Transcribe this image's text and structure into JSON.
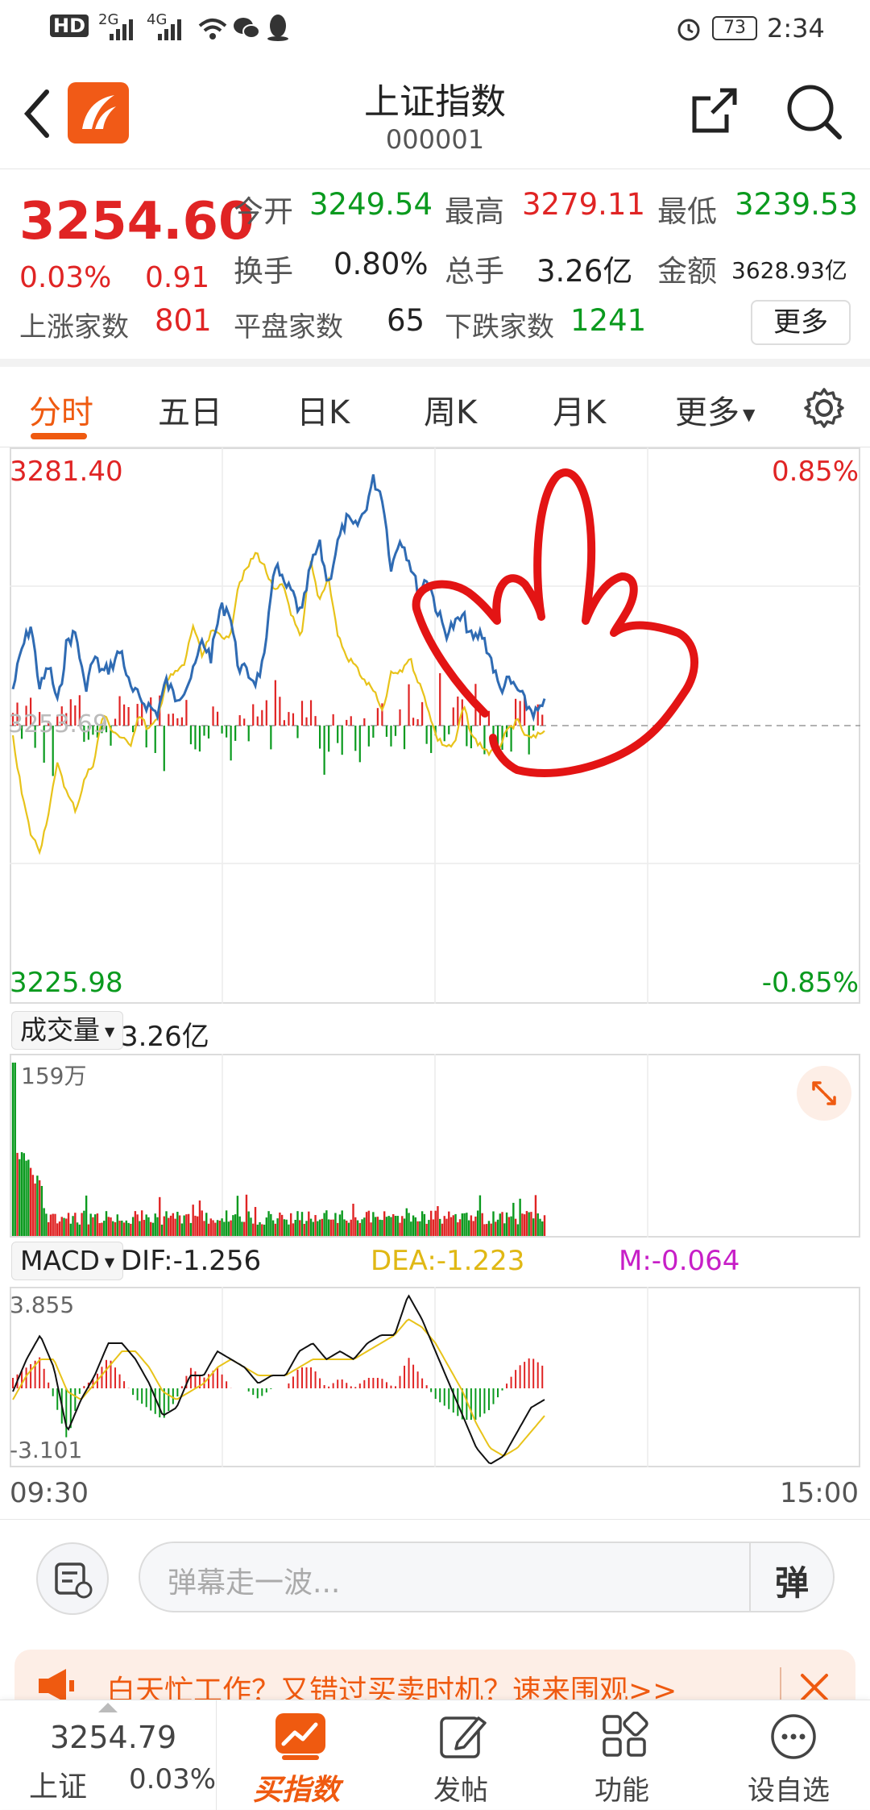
{
  "status_bar": {
    "hd": "HD",
    "net1": "2G",
    "net2": "4G",
    "battery": "73",
    "time": "2:34"
  },
  "nav": {
    "title": "上证指数",
    "code": "000001"
  },
  "quote": {
    "price": "3254.60",
    "change_pct": "0.03%",
    "change": "0.91",
    "open_label": "今开",
    "open": "3249.54",
    "high_label": "最高",
    "high": "3279.11",
    "low_label": "最低",
    "low": "3239.53",
    "turnover_label": "换手",
    "turnover": "0.80%",
    "volume_label": "总手",
    "volume": "3.26亿",
    "amount_label": "金额",
    "amount": "3628.93亿",
    "up_label": "上涨家数",
    "up": "801",
    "flat_label": "平盘家数",
    "flat": "65",
    "down_label": "下跌家数",
    "down": "1241",
    "more": "更多"
  },
  "tabs": [
    "分时",
    "五日",
    "日K",
    "周K",
    "月K",
    "更多"
  ],
  "price_chart": {
    "max_price": "3281.40",
    "min_price": "3225.98",
    "max_pct": "0.85%",
    "min_pct": "-0.85%",
    "prev_close_faded": "3253.69"
  },
  "volume_panel": {
    "label": "成交量",
    "total": "3.26亿",
    "max": "159万"
  },
  "macd_panel": {
    "label": "MACD",
    "dif": "DIF:-1.256",
    "dea": "DEA:-1.223",
    "m": "M:-0.064",
    "max": "3.855",
    "min": "-3.101"
  },
  "time_axis": {
    "start": "09:30",
    "end": "15:00"
  },
  "danmaku": {
    "placeholder": "弹幕走一波...",
    "send": "弹"
  },
  "banner": {
    "text": "白天忙工作？又错过买卖时机？速来围观>>"
  },
  "bottom_nav": {
    "index_price": "3254.79",
    "index_name": "上证",
    "index_pct": "0.03%",
    "buy_label": "买指数",
    "post_label": "发帖",
    "func_label": "功能",
    "fav_label": "设自选"
  },
  "colors": {
    "accent": "#ef5a10",
    "up": "#e02424",
    "down": "#0a9a1e",
    "price_line": "#2f6bb3",
    "avg_line": "#e8c31a",
    "annotation": "#e31414"
  }
}
